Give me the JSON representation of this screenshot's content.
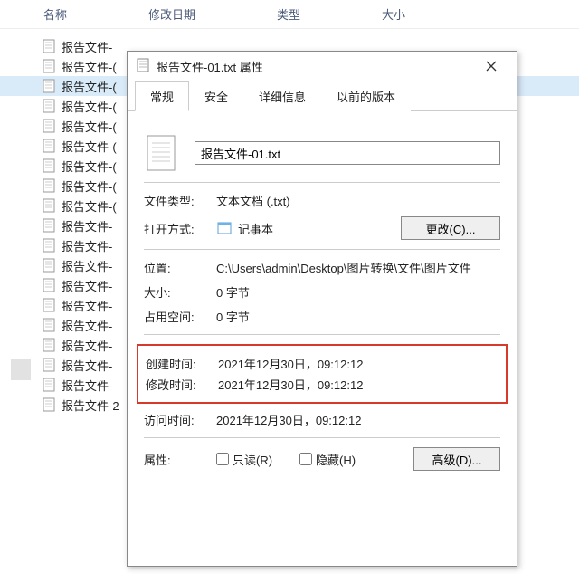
{
  "columns": {
    "name": "名称",
    "modified": "修改日期",
    "type": "类型",
    "size": "大小"
  },
  "file_items": [
    "报告文件-",
    "报告文件-(",
    "报告文件-(",
    "报告文件-(",
    "报告文件-(",
    "报告文件-(",
    "报告文件-(",
    "报告文件-(",
    "报告文件-(",
    "报告文件-",
    "报告文件-",
    "报告文件-",
    "报告文件-",
    "报告文件-",
    "报告文件-",
    "报告文件-",
    "报告文件-",
    "报告文件-",
    "报告文件-2"
  ],
  "dialog": {
    "title": "报告文件-01.txt 属性",
    "tabs": {
      "general": "常规",
      "security": "安全",
      "details": "详细信息",
      "previous": "以前的版本"
    },
    "filename": "报告文件-01.txt",
    "labels": {
      "filetype": "文件类型:",
      "openwith": "打开方式:",
      "location": "位置:",
      "size": "大小:",
      "sizeondisk": "占用空间:",
      "created": "创建时间:",
      "modified": "修改时间:",
      "accessed": "访问时间:",
      "attributes": "属性:"
    },
    "values": {
      "filetype": "文本文档 (.txt)",
      "openwith_app": "记事本",
      "location": "C:\\Users\\admin\\Desktop\\图片转换\\文件\\图片文件",
      "size": "0 字节",
      "sizeondisk": "0 字节",
      "created": "2021年12月30日，09:12:12",
      "modified": "2021年12月30日，09:12:12",
      "accessed": "2021年12月30日，09:12:12"
    },
    "buttons": {
      "change": "更改(C)...",
      "advanced": "高级(D)..."
    },
    "checkboxes": {
      "readonly": "只读(R)",
      "hidden": "隐藏(H)"
    }
  }
}
